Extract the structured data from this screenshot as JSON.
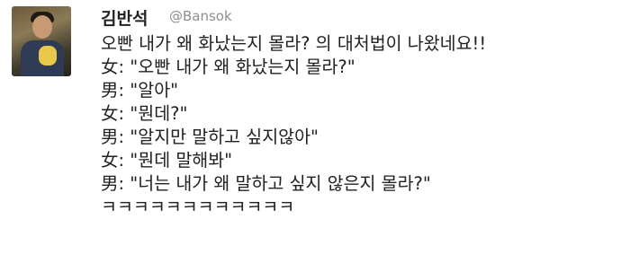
{
  "tweet": {
    "display_name": "김반석",
    "handle": "@Bansok",
    "lines": [
      {
        "speaker": "",
        "text": "오빤 내가 왜 화났는지 몰라? 의 대처법이 나왔네요!!"
      },
      {
        "speaker": "女",
        "text": ": \"오빤 내가 왜 화났는지 몰라?\""
      },
      {
        "speaker": "男",
        "text": ": \"알아\""
      },
      {
        "speaker": "女",
        "text": ": \"뭔데?\""
      },
      {
        "speaker": "男",
        "text": ": \"알지만 말하고 싶지않아\""
      },
      {
        "speaker": "女",
        "text": ": \"뭔데 말해봐\""
      },
      {
        "speaker": "男",
        "text": ": \"너는 내가 왜 말하고 싶지 않은지 몰라?\""
      },
      {
        "speaker": "",
        "text": "ㅋㅋㅋㅋㅋㅋㅋㅋㅋㅋㅋㅋ"
      }
    ]
  }
}
